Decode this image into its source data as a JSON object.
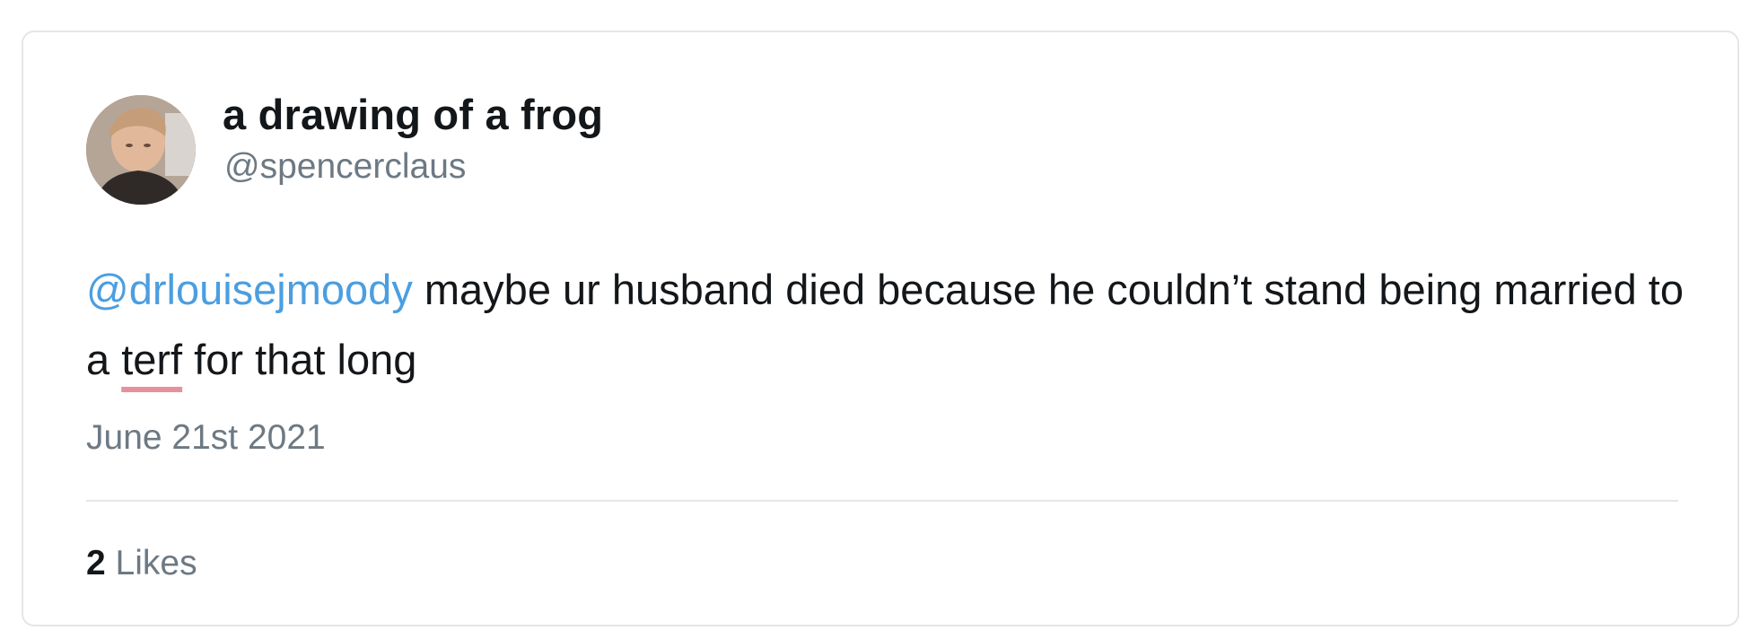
{
  "author": {
    "display_name": "a drawing of a frog",
    "handle": "@spencerclaus",
    "avatar_icon": "user-avatar-photo"
  },
  "tweet": {
    "mention": "@drlouisejmoody",
    "text_part1": " maybe ur husband died because he couldn’t stand being married to a ",
    "flagged_word": "terf",
    "text_part2": " for that long",
    "date": "June 21st 2021"
  },
  "stats": {
    "likes_count": "2",
    "likes_label": "Likes"
  },
  "colors": {
    "mention": "#4b9ee0",
    "text": "#14171a",
    "muted": "#6d7983",
    "border": "#e3e6ea",
    "spellcheck_underline": "#e88f9e"
  }
}
